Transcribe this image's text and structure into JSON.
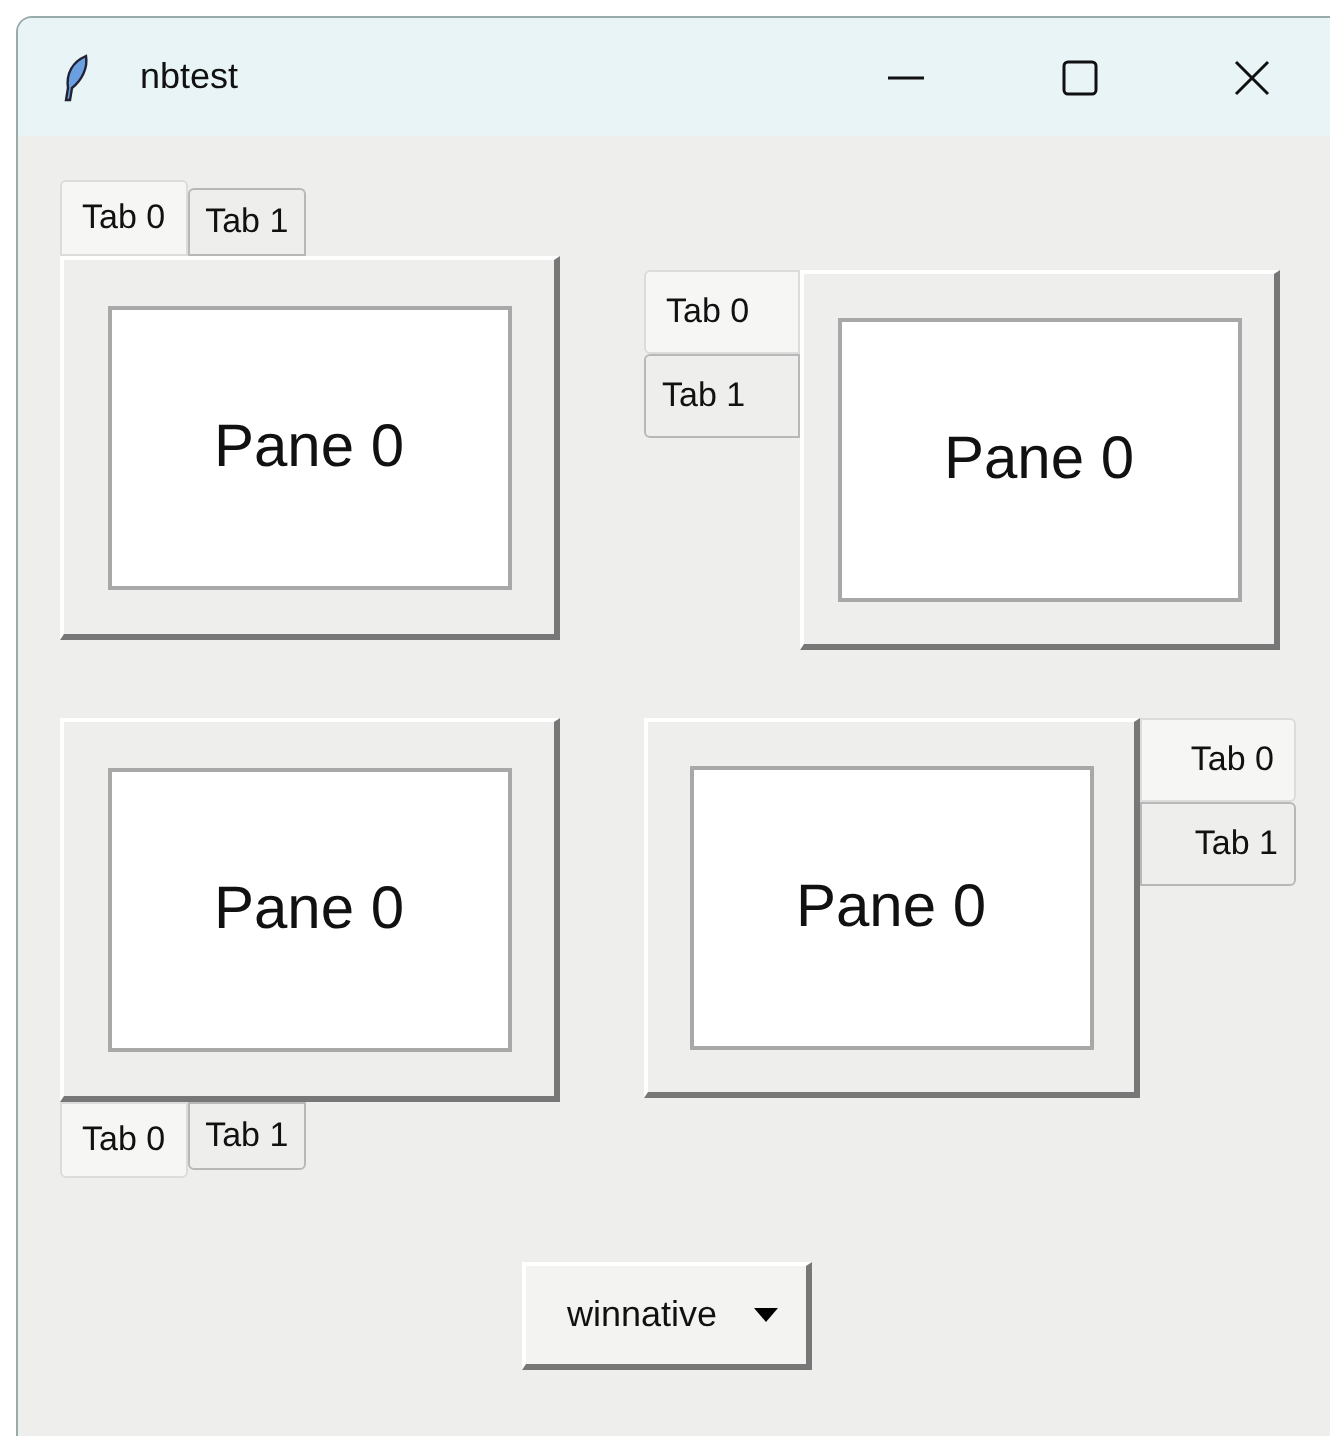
{
  "window": {
    "title": "nbtest"
  },
  "notebooks": [
    {
      "kind": "top",
      "tabs": [
        {
          "label": "Tab 0",
          "selected": true
        },
        {
          "label": "Tab 1",
          "selected": false
        }
      ],
      "pane": "Pane 0"
    },
    {
      "kind": "left",
      "tabs": [
        {
          "label": "Tab 0",
          "selected": true
        },
        {
          "label": "Tab 1",
          "selected": false
        }
      ],
      "pane": "Pane 0"
    },
    {
      "kind": "bottom",
      "tabs": [
        {
          "label": "Tab 0",
          "selected": true
        },
        {
          "label": "Tab 1",
          "selected": false
        }
      ],
      "pane": "Pane 0"
    },
    {
      "kind": "right",
      "tabs": [
        {
          "label": "Tab 0",
          "selected": true
        },
        {
          "label": "Tab 1",
          "selected": false
        }
      ],
      "pane": "Pane 0"
    }
  ],
  "theme_combobox": {
    "value": "winnative"
  }
}
